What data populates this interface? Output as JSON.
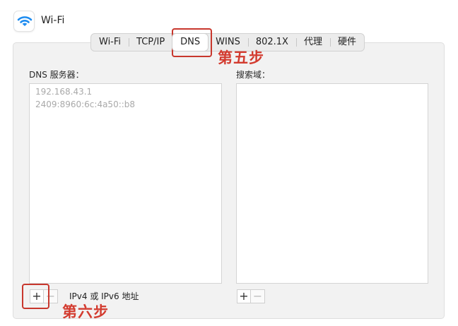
{
  "header": {
    "title": "Wi-Fi",
    "icon": "wifi-icon"
  },
  "tabs": [
    {
      "label": "Wi-Fi",
      "active": false
    },
    {
      "label": "TCP/IP",
      "active": false
    },
    {
      "label": "DNS",
      "active": true
    },
    {
      "label": "WINS",
      "active": false
    },
    {
      "label": "802.1X",
      "active": false
    },
    {
      "label": "代理",
      "active": false
    },
    {
      "label": "硬件",
      "active": false
    }
  ],
  "dns": {
    "label": "DNS 服务器：",
    "servers": [
      "192.168.43.1",
      "2409:8960:6c:4a50::b8"
    ],
    "add_label": "+",
    "remove_label": "−",
    "hint": "IPv4 或 IPv6 地址"
  },
  "search_domains": {
    "label": "搜索域：",
    "items": [],
    "add_label": "+",
    "remove_label": "−"
  },
  "annotations": {
    "step5": "第五步",
    "step6": "第六步"
  },
  "colors": {
    "annotation": "#c8372d",
    "wifi_blue": "#1e8cf0",
    "panel_bg": "#f2f2f2",
    "placeholder_text": "#a9a9a9"
  }
}
